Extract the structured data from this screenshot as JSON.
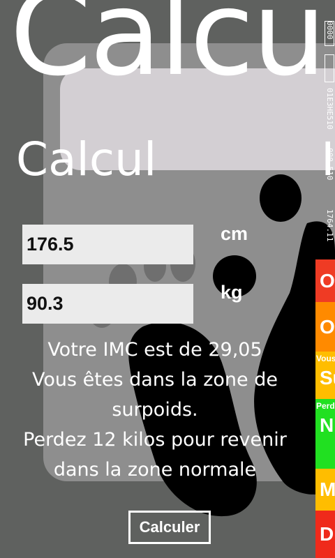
{
  "panorama": {
    "title": "Calcul"
  },
  "section": {
    "title": "Calcul",
    "next_title_peek": "I"
  },
  "height_field": {
    "value": "176.5",
    "unit": "cm"
  },
  "weight_field": {
    "value": "90.3",
    "unit": "kg"
  },
  "result": {
    "line1": "Votre IMC est de 29,05",
    "line2": "Vous êtes dans la zone de",
    "line3": "surpoids.",
    "line4": "Perdez 12 kilos pour revenir",
    "line5": "dans la zone normale"
  },
  "calculate_button": {
    "label": "Calculer"
  },
  "side_peek": {
    "code_top": "0000",
    "code_mid": "01E3HE510",
    "code_low": "000 510",
    "code_bottom": "1764.11",
    "zones": [
      {
        "big": "O",
        "small": "",
        "color": "#ef3b24"
      },
      {
        "big": "O",
        "small": "",
        "color": "#ff8a00"
      },
      {
        "big": "Su",
        "small": "Vous",
        "color": "#ffbd00"
      },
      {
        "big": "N",
        "small": "Perd",
        "color": "#21e021"
      },
      {
        "big": "M",
        "small": "",
        "color": "#ffbd00"
      },
      {
        "big": "D",
        "small": "",
        "color": "#ef2a1b"
      }
    ]
  },
  "colors": {
    "background": "#5f615f",
    "scale": "#8e8e8e",
    "scale_display": "#d3cfd3",
    "field": "#ebebeb"
  }
}
